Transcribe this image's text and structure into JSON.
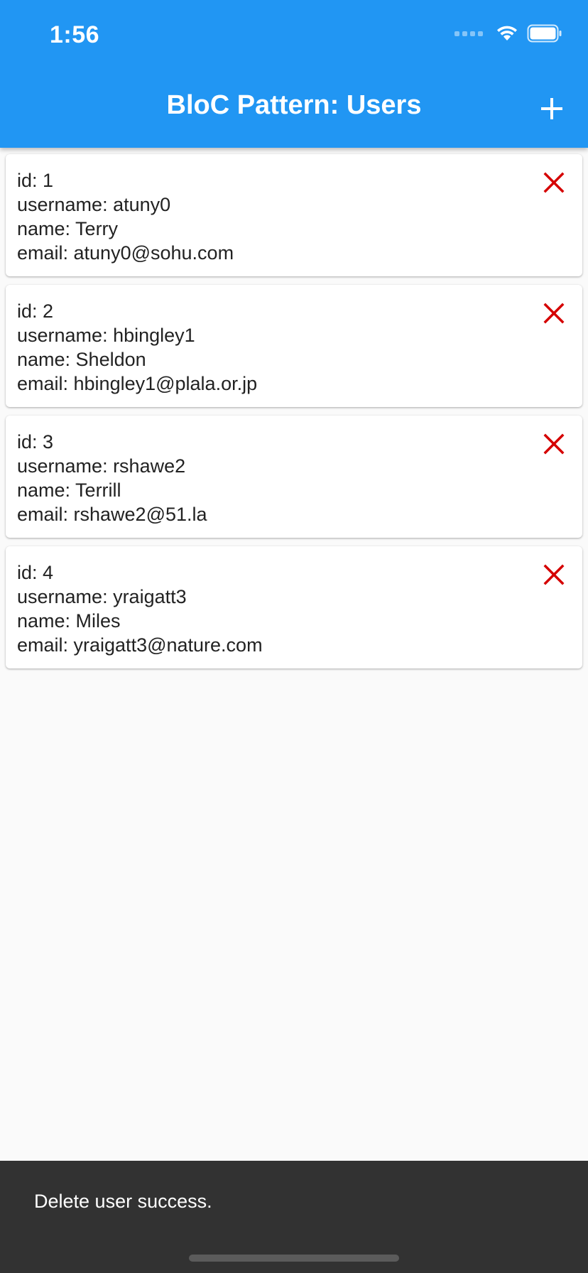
{
  "status_bar": {
    "time": "1:56"
  },
  "app_bar": {
    "title": "BloC Pattern: Users",
    "background": "#2196f3",
    "add_icon": "plus-icon"
  },
  "users": [
    {
      "id_line": "id: 1",
      "username_line": "username: atuny0",
      "name_line": "name: Terry",
      "email_line": "email: atuny0@sohu.com"
    },
    {
      "id_line": "id: 2",
      "username_line": "username: hbingley1",
      "name_line": "name: Sheldon",
      "email_line": "email: hbingley1@plala.or.jp"
    },
    {
      "id_line": "id: 3",
      "username_line": "username: rshawe2",
      "name_line": "name: Terrill",
      "email_line": "email: rshawe2@51.la"
    },
    {
      "id_line": "id: 4",
      "username_line": "username: yraigatt3",
      "name_line": "name: Miles",
      "email_line": "email: yraigatt3@nature.com"
    }
  ],
  "delete_icon": {
    "name": "close-icon",
    "color": "#d50000"
  },
  "snackbar": {
    "message": "Delete user success.",
    "background": "#323232"
  }
}
